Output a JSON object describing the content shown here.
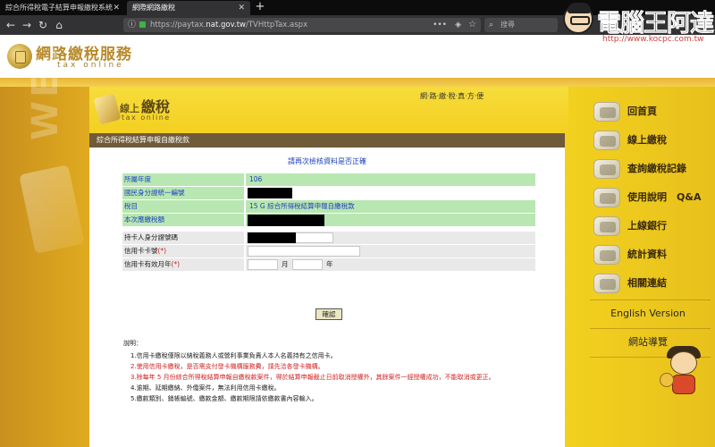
{
  "browser": {
    "tabs": [
      {
        "title": "綜合所得稅電子結算申報繳稅系統",
        "active": false
      },
      {
        "title": "網際網路繳稅",
        "active": true
      }
    ],
    "url_prefix": "https://paytax.",
    "url_domain": "nat.gov.tw",
    "url_path": "/TVHttpTax.aspx",
    "search_placeholder": "搜尋",
    "icons": [
      "back-icon",
      "forward-icon",
      "reload-icon",
      "home-icon",
      "info-icon",
      "lock-icon",
      "more-icon",
      "shield-icon",
      "bookmark-star-icon",
      "search-icon"
    ]
  },
  "watermark": {
    "brand": "電腦王阿達",
    "url": "http://www.kocpc.com.tw"
  },
  "site": {
    "logo_title": "網路繳稅服務",
    "logo_sub": "tax online",
    "section_logo_small": "線上",
    "section_logo_big": "繳稅",
    "section_logo_sub": "tax online",
    "top_nav": "網‧路‧繳‧稅‧真‧方‧便"
  },
  "panel": {
    "title": "綜合所得稅結算申報自繳稅款",
    "verify_note": "請再次檢核資料是否正確",
    "rows": [
      {
        "label": "所屬年度",
        "value": "106"
      },
      {
        "label": "國民身分證統一編號",
        "value": ""
      },
      {
        "label": "稅目",
        "value": "15 G 綜合所得稅結算申報自繳稅款"
      },
      {
        "label": "本次應繳稅額",
        "value": ""
      }
    ],
    "form": {
      "holder_id_label": "持卡人身分證號碼",
      "card_number_label": "信用卡卡號",
      "expiry_label": "信用卡有效月年",
      "required_mark": "(*)",
      "month_unit": "月",
      "year_unit": "年",
      "card_number_value": "",
      "month_value": "",
      "year_value": ""
    },
    "confirm_button": "確認",
    "notes_heading": "說明：",
    "notes": [
      {
        "text": "1.信用卡繳稅僅限以納稅義務人或營利事業負責人本人名義持有之信用卡。",
        "red": false
      },
      {
        "text": "2.使用信用卡繳稅，是否需支付發卡機構服務費，請先洽各發卡機構。",
        "red": true
      },
      {
        "text": "3.除每年 5 月份綜合所得稅結算申報自繳稅款案件，得於結算申報截止日前取消授權外，其餘案件一經授權成功，不能取消或更正。",
        "red": true
      },
      {
        "text": "4.逾期、延期繳納、外僑案件，無法利用信用卡繳稅。",
        "red": false
      },
      {
        "text": "5.繳款類別、銷帳編號、繳款金額、繳款期限請依繳款書內容輸入。",
        "red": false
      }
    ]
  },
  "sidebar": {
    "items": [
      {
        "label": "回首頁",
        "icon": "home-photo-icon"
      },
      {
        "label": "線上繳稅",
        "icon": "online-tax-photo-icon"
      },
      {
        "label": "查詢繳稅記錄",
        "icon": "query-records-photo-icon"
      },
      {
        "label": "使用說明　Q&A",
        "icon": "help-photo-icon"
      },
      {
        "label": "上線銀行",
        "icon": "bank-photo-icon"
      },
      {
        "label": "統計資料",
        "icon": "statistics-photo-icon"
      },
      {
        "label": "相關連結",
        "icon": "related-links-icon"
      }
    ],
    "english_version": "English Version",
    "site_guide": "網站導覽"
  },
  "colors": {
    "panel_title_bg": "#6f5a3a",
    "green_row": "#b8e7b1",
    "blue_text": "#1a3fbf",
    "red_text": "#d02020",
    "yellow_bg": "#f4d21e"
  }
}
